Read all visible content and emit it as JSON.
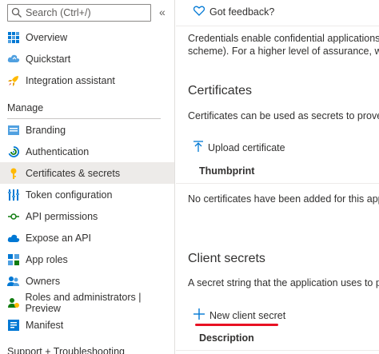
{
  "sidebar": {
    "search_placeholder": "Search (Ctrl+/)",
    "collapse_glyph": "«",
    "top_items": [
      {
        "label": "Overview",
        "icon": "overview-grid-icon"
      },
      {
        "label": "Quickstart",
        "icon": "quickstart-cloud-icon"
      },
      {
        "label": "Integration assistant",
        "icon": "rocket-icon"
      }
    ],
    "manage_label": "Manage",
    "manage_items": [
      {
        "label": "Branding",
        "icon": "branding-icon"
      },
      {
        "label": "Authentication",
        "icon": "authentication-icon"
      },
      {
        "label": "Certificates & secrets",
        "icon": "key-icon"
      },
      {
        "label": "Token configuration",
        "icon": "token-bars-icon"
      },
      {
        "label": "API permissions",
        "icon": "api-permissions-icon"
      },
      {
        "label": "Expose an API",
        "icon": "expose-api-cloud-icon"
      },
      {
        "label": "App roles",
        "icon": "app-roles-grid-icon"
      },
      {
        "label": "Owners",
        "icon": "owners-people-icon"
      },
      {
        "label": "Roles and administrators | Preview",
        "icon": "roles-admin-icon"
      },
      {
        "label": "Manifest",
        "icon": "manifest-icon"
      }
    ],
    "support_label": "Support + Troubleshooting"
  },
  "main": {
    "feedback_label": "Got feedback?",
    "intro_line1": "Credentials enable confidential applications to ide",
    "intro_line2": "scheme). For a higher level of assurance, we recor",
    "certificates": {
      "title": "Certificates",
      "description": "Certificates can be used as secrets to prove the ap",
      "upload_label": "Upload certificate",
      "column_thumbprint": "Thumbprint",
      "empty_text": "No certificates have been added for this applicati"
    },
    "client_secrets": {
      "title": "Client secrets",
      "description": "A secret string that the application uses to prove",
      "new_label": "New client secret",
      "column_description": "Description"
    }
  },
  "colors": {
    "accent_blue": "#0078d4",
    "active_bg": "#edebe9",
    "highlight_red": "#e81123"
  }
}
